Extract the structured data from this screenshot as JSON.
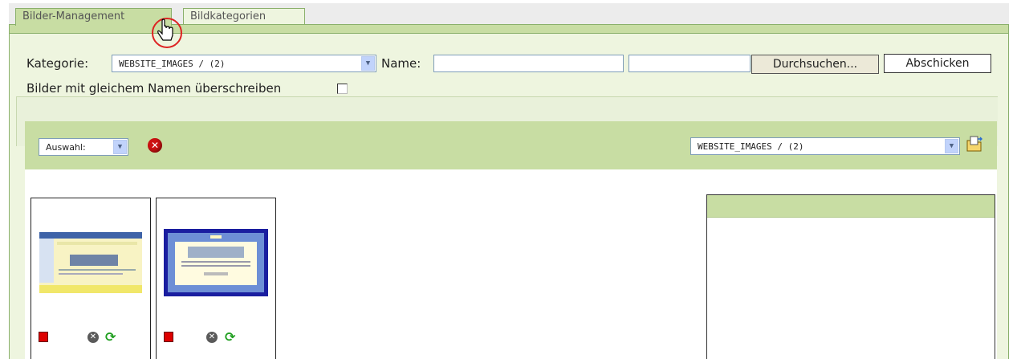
{
  "tabs": [
    {
      "label": "Bilder-Management",
      "active": true
    },
    {
      "label": "Bildkategorien",
      "active": false
    }
  ],
  "form": {
    "category_label": "Kategorie:",
    "category_value": "WEBSITE_IMAGES / (2)",
    "name_label": "Name:",
    "name_value": "",
    "file_value": "",
    "browse_label": "Durchsuchen...",
    "submit_label": "Abschicken",
    "overwrite_label": "Bilder mit gleichem Namen überschreiben",
    "overwrite_checked": false
  },
  "toolbar": {
    "selection_value": "Auswahl:",
    "category_value": "WEBSITE_IMAGES / (2)"
  },
  "images": [
    {
      "thumb_style": "yellow-blue-website"
    },
    {
      "thumb_style": "blue-framed-website"
    }
  ],
  "icons": {
    "delete": "red-x-circle-icon",
    "upload": "folder-upload-icon",
    "thumb_delete": "grey-x-circle-icon",
    "thumb_refresh": "green-refresh-icon",
    "cursor": "hand-pointer-icon"
  },
  "colors": {
    "panel_bg": "#eef5df",
    "accent_green": "#c8dda3",
    "border_green": "#8ab06b",
    "delete_red": "#cc1111"
  }
}
